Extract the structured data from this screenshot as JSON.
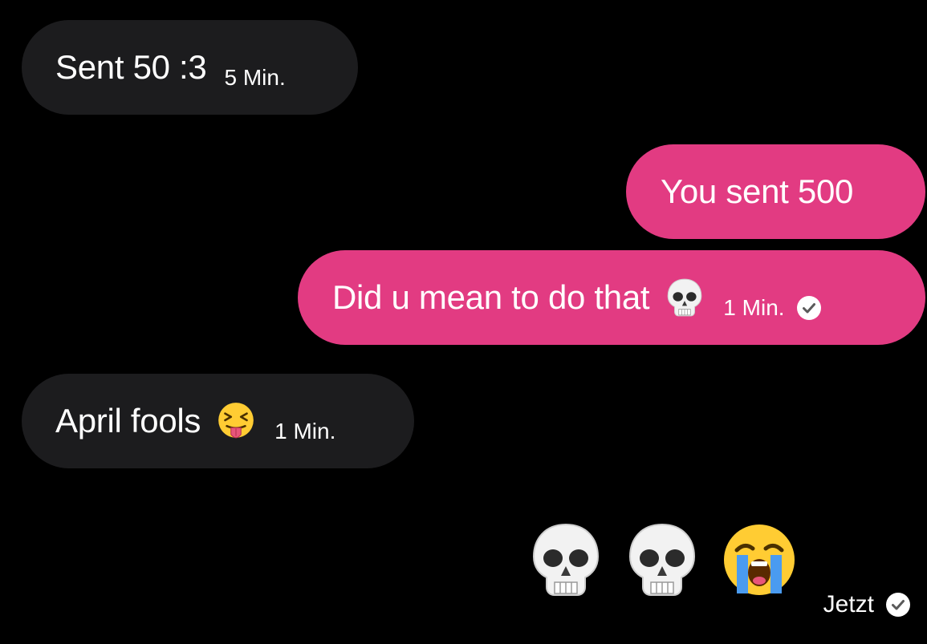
{
  "colors": {
    "background": "#000000",
    "incoming_bubble": "#1c1c1e",
    "outgoing_bubble": "#e23b82",
    "text": "#ffffff"
  },
  "messages": [
    {
      "direction": "incoming",
      "text": "Sent 50 :3",
      "time": "5 Min."
    },
    {
      "direction": "outgoing",
      "text": "You sent 500"
    },
    {
      "direction": "outgoing",
      "text": "Did u mean to do that",
      "emoji": "skull-icon",
      "time": "1 Min.",
      "read_icon": "check-circle-icon"
    },
    {
      "direction": "incoming",
      "text": "April fools",
      "emoji": "squinting-tongue-face-icon",
      "time": "1 Min."
    }
  ],
  "emoji_message": {
    "emojis": [
      "skull-icon",
      "skull-icon",
      "loudly-crying-face-icon"
    ],
    "status": "Jetzt",
    "status_icon": "check-circle-icon"
  }
}
